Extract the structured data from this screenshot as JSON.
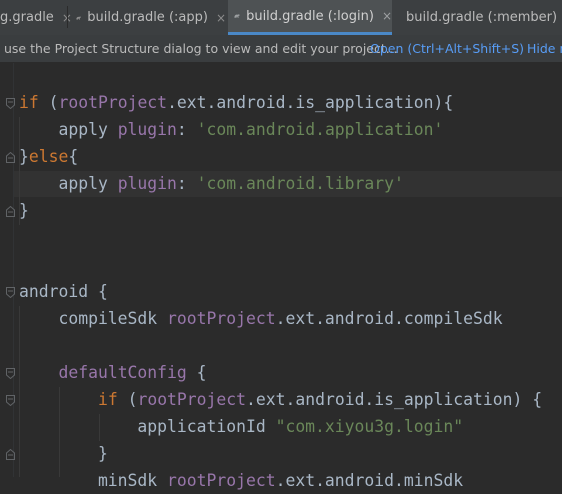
{
  "tabs": [
    {
      "label": "g.gradle",
      "active": false
    },
    {
      "label": "build.gradle (:app)",
      "active": false
    },
    {
      "label": "build.gradle (:login)",
      "active": true
    },
    {
      "label": "build.gradle (:member)",
      "active": false
    }
  ],
  "close_glyph": "×",
  "notification": {
    "message": "use the Project Structure dialog to view and edit your project...",
    "open_link": "Open (Ctrl+Alt+Shift+S)",
    "hide_link": "Hide n"
  },
  "code": {
    "l1": {
      "a": "if",
      "b": " (",
      "c": "rootProject",
      "d": ".ext.android.is_application){"
    },
    "l2": {
      "a": "    apply ",
      "b": "plugin",
      "c": ": ",
      "d": "'com.android.application'"
    },
    "l3": {
      "a": "}",
      "b": "else",
      "c": "{"
    },
    "l4": {
      "a": "    apply ",
      "b": "plugin",
      "c": ": ",
      "d": "'com.android.library'"
    },
    "l5": {
      "a": "}"
    },
    "l6": {
      "a": "android",
      "b": " {"
    },
    "l7": {
      "a": "    compileSdk ",
      "b": "rootProject",
      "c": ".ext.android.compileSdk"
    },
    "l8": {
      "a": "    ",
      "b": "defaultConfig",
      "c": " {"
    },
    "l9": {
      "a": "        ",
      "b": "if",
      "c": " (",
      "d": "rootProject",
      "e": ".ext.android.is_application) {"
    },
    "l10": {
      "a": "            applicationId ",
      "b": "\"com.xiyou3g.login\""
    },
    "l11": {
      "a": "        }"
    },
    "l12": {
      "a": "        minSdk ",
      "b": "rootProject",
      "c": ".ext.android.minSdk"
    }
  },
  "colors": {
    "keyword": "#cc7832",
    "property": "#9876aa",
    "string": "#6a8759",
    "text": "#a9b7c6",
    "link": "#589df6",
    "background": "#2b2b2b"
  }
}
